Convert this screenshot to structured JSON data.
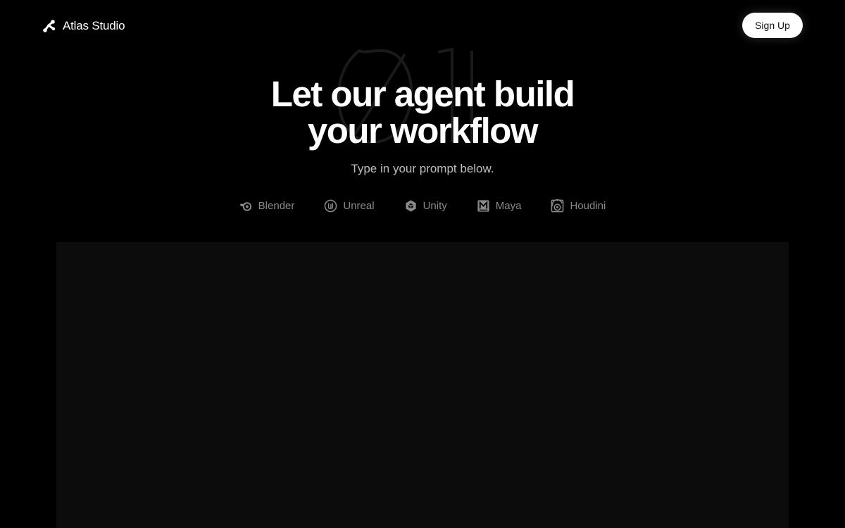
{
  "brand": {
    "name": "Atlas Studio",
    "logo_icon": "nodes-icon"
  },
  "header": {
    "signup_label": "Sign Up"
  },
  "hero": {
    "title_line1": "Let our agent build",
    "title_line2": "your workflow",
    "subtitle": "Type in your prompt below."
  },
  "tools": [
    {
      "label": "Blender",
      "icon": "blender-icon"
    },
    {
      "label": "Unreal",
      "icon": "unreal-icon"
    },
    {
      "label": "Unity",
      "icon": "unity-icon"
    },
    {
      "label": "Maya",
      "icon": "maya-icon"
    },
    {
      "label": "Houdini",
      "icon": "houdini-icon"
    }
  ],
  "colors": {
    "background": "#000000",
    "panel": "#0c0c0c",
    "text": "#ffffff",
    "muted": "#8a8a8a",
    "subtitle": "#bdbdbd"
  }
}
